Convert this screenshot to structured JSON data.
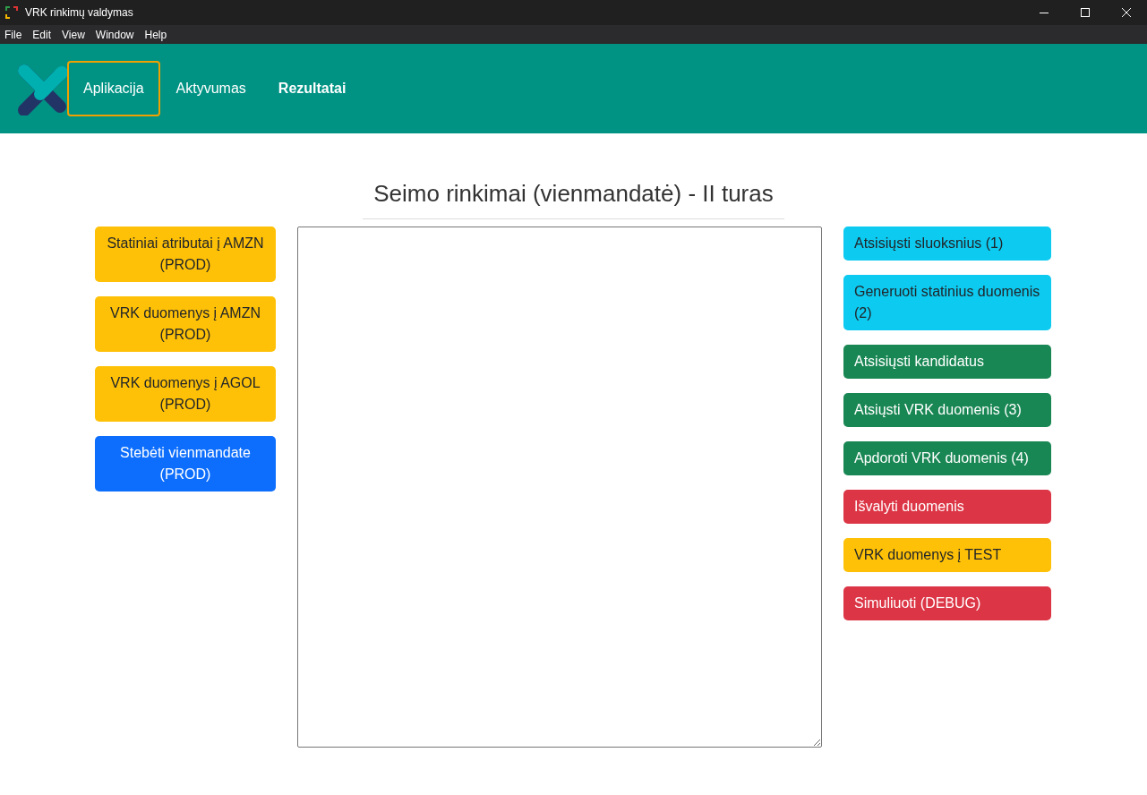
{
  "window": {
    "title": "VRK rinkimų valdymas"
  },
  "menu": [
    "File",
    "Edit",
    "View",
    "Window",
    "Help"
  ],
  "nav": [
    {
      "label": "Aplikacija",
      "selected": false,
      "focused": true
    },
    {
      "label": "Aktyvumas",
      "selected": false,
      "focused": false
    },
    {
      "label": "Rezultatai",
      "selected": true,
      "focused": false
    }
  ],
  "heading": "Seimo rinkimai (vienmandatė) - II turas",
  "left_buttons": [
    {
      "label": "Statiniai atributai į AMZN (PROD)",
      "kind": "warning"
    },
    {
      "label": "VRK duomenys į AMZN (PROD)",
      "kind": "warning"
    },
    {
      "label": "VRK duomenys į AGOL (PROD)",
      "kind": "warning"
    },
    {
      "label": "Stebėti vienmandate (PROD)",
      "kind": "primary"
    }
  ],
  "right_buttons": [
    {
      "label": "Atsisiųsti sluoksnius (1)",
      "kind": "info"
    },
    {
      "label": "Generuoti statinius duomenis (2)",
      "kind": "info"
    },
    {
      "label": "Atsisiųsti kandidatus",
      "kind": "success"
    },
    {
      "label": "Atsiųsti VRK duomenis (3)",
      "kind": "success"
    },
    {
      "label": "Apdoroti VRK duomenis (4)",
      "kind": "success"
    },
    {
      "label": "Išvalyti duomenis",
      "kind": "danger"
    },
    {
      "label": "VRK duomenys į TEST",
      "kind": "warning"
    },
    {
      "label": "Simuliuoti (DEBUG)",
      "kind": "danger"
    }
  ]
}
